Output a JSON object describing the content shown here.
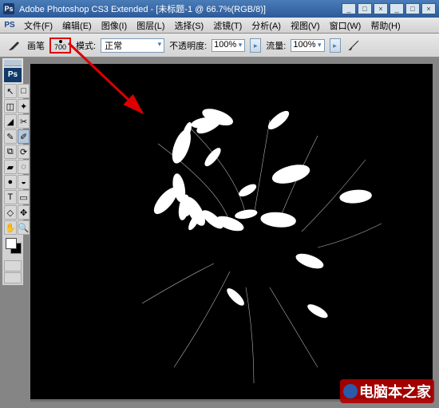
{
  "titlebar": {
    "logo": "Ps",
    "app": "Adobe Photoshop CS3 Extended",
    "doc": "[未标题-1 @ 66.7%(RGB/8)]",
    "min": "_",
    "max": "□",
    "close": "×",
    "min2": "_",
    "max2": "□",
    "close2": "×"
  },
  "menubar": {
    "logo": "PS",
    "items": [
      "文件(F)",
      "编辑(E)",
      "图像(I)",
      "图层(L)",
      "选择(S)",
      "滤镜(T)",
      "分析(A)",
      "视图(V)",
      "窗口(W)",
      "帮助(H)"
    ]
  },
  "options": {
    "brush_label": "画笔",
    "brush_size": "700",
    "mode_label": "模式:",
    "mode_value": "正常",
    "opacity_label": "不透明度:",
    "opacity_value": "100%",
    "flow_label": "流量:",
    "flow_value": "100%"
  },
  "toolbox": {
    "logo": "Ps",
    "tools": [
      "↖",
      "□",
      "◫",
      "✦",
      "◢",
      "✂",
      "✎",
      "✐",
      "⧉",
      "⟳",
      "▰",
      "◌",
      "●",
      "◒",
      "T",
      "▭",
      "◇",
      "✥",
      "✋",
      "🔍"
    ]
  },
  "watermark": {
    "text": "电脑本之家"
  }
}
